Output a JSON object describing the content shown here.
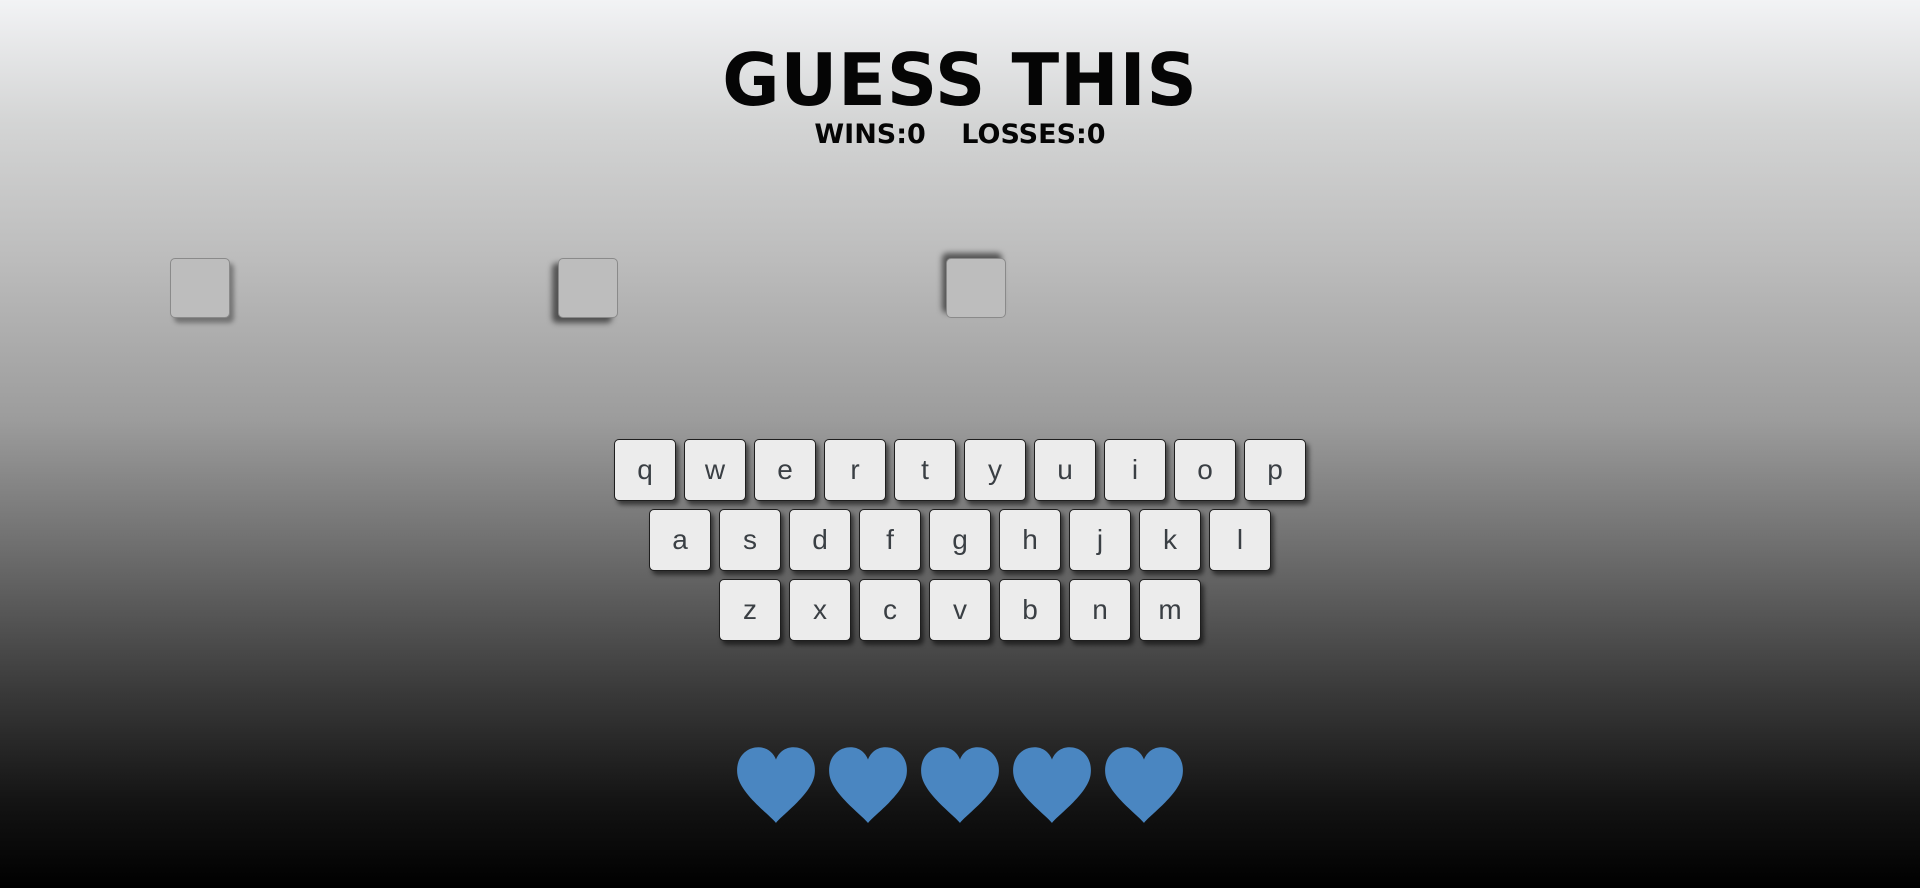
{
  "title": "GUESS THIS",
  "score": {
    "wins_label": "WINS:0",
    "losses_label": "LOSSES:0",
    "wins": 0,
    "losses": 0
  },
  "word": {
    "letters": [
      "",
      "",
      ""
    ]
  },
  "keyboard": {
    "rows": [
      [
        "q",
        "w",
        "e",
        "r",
        "t",
        "y",
        "u",
        "i",
        "o",
        "p"
      ],
      [
        "a",
        "s",
        "d",
        "f",
        "g",
        "h",
        "j",
        "k",
        "l"
      ],
      [
        "z",
        "x",
        "c",
        "v",
        "b",
        "n",
        "m"
      ]
    ]
  },
  "lives": {
    "remaining": 5,
    "total": 5,
    "icon": "heart-icon",
    "color": "#4a86c1"
  }
}
